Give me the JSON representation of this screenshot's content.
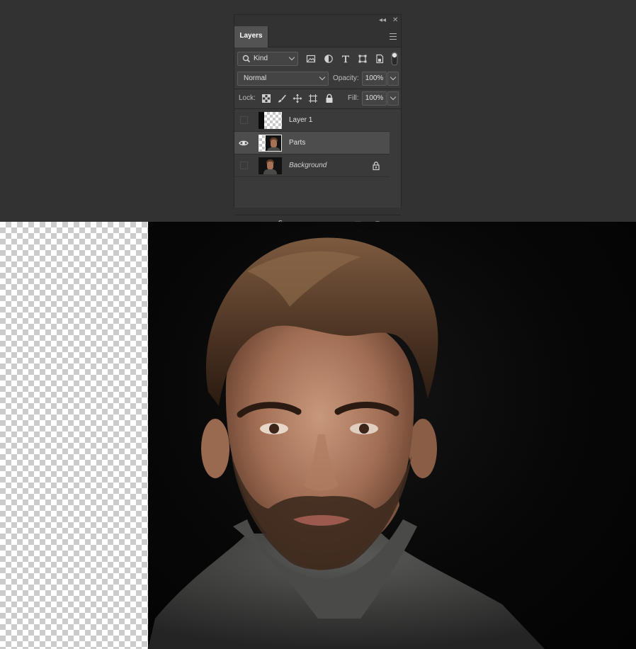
{
  "panel": {
    "collapse_glyph": "◂◂",
    "close_glyph": "✕",
    "tab_label": "Layers",
    "menu_icon": "panel-menu-icon"
  },
  "filter": {
    "kind_label": "Kind",
    "icons": [
      "image-filter-icon",
      "adjustment-filter-icon",
      "type-filter-icon",
      "shape-filter-icon",
      "smart-object-filter-icon",
      "filter-toggle-icon"
    ]
  },
  "blend": {
    "mode": "Normal",
    "opacity_label": "Opacity:",
    "opacity_value": "100%"
  },
  "lock": {
    "label": "Lock:",
    "icons": [
      "lock-transparent-icon",
      "lock-image-icon",
      "lock-position-icon",
      "lock-artboard-icon",
      "lock-all-icon"
    ],
    "fill_label": "Fill:",
    "fill_value": "100%"
  },
  "layers": [
    {
      "name": "Layer 1",
      "visible": false,
      "selected": false,
      "locked": false,
      "thumb": "transparent"
    },
    {
      "name": "Parts",
      "visible": true,
      "selected": true,
      "locked": false,
      "thumb": "portrait"
    },
    {
      "name": "Background",
      "visible": false,
      "selected": false,
      "locked": true,
      "thumb": "portrait"
    }
  ],
  "footer_icons": [
    "link-layers-icon",
    "fx-icon",
    "add-mask-icon",
    "new-fill-adjustment-icon",
    "new-group-icon",
    "new-layer-icon",
    "delete-layer-icon"
  ],
  "footer": {
    "fx_text": "fx"
  },
  "colors": {
    "app_bg": "#323232",
    "panel_bg": "#3a3a3a",
    "selected_row": "#4d4d4d"
  }
}
